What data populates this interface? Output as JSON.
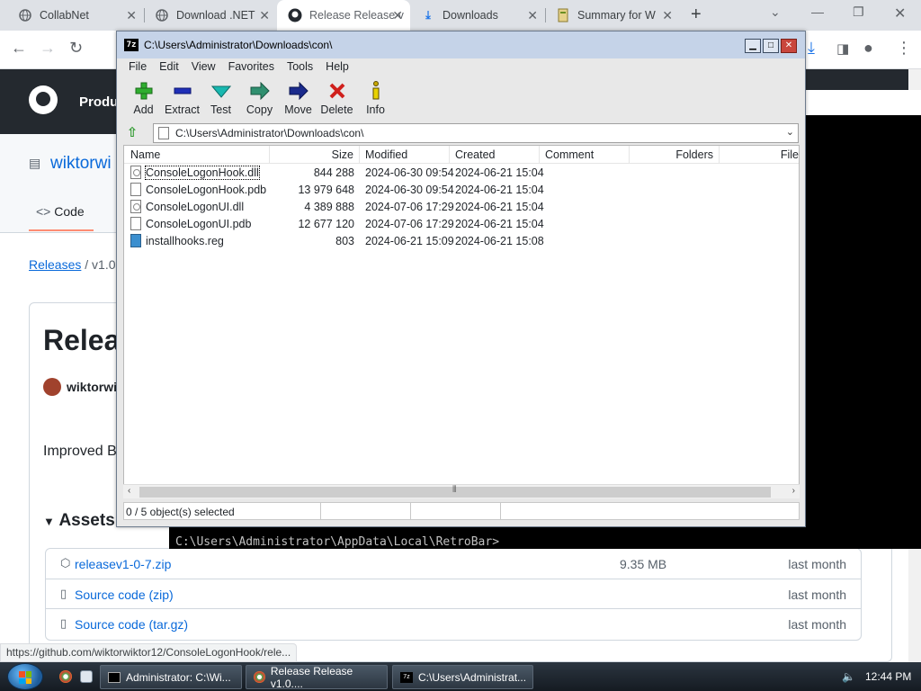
{
  "browser": {
    "tabs": [
      {
        "title": "CollabNet",
        "icon": "globe-icon"
      },
      {
        "title": "Download .NET",
        "icon": "globe-icon"
      },
      {
        "title": "Release Release v",
        "icon": "github-icon",
        "active": true
      },
      {
        "title": "Downloads",
        "icon": "download-icon"
      },
      {
        "title": "Summary for W",
        "icon": "summary-icon"
      }
    ],
    "status_url": "https://github.com/wiktorwiktor12/ConsoleLogonHook/rele..."
  },
  "github": {
    "nav_product": "Produ",
    "repo_name": "wiktorwi",
    "code_tab": "Code",
    "breadcrumb_link": "Releases",
    "breadcrumb_sep": "/",
    "breadcrumb_current": "v1.0.7",
    "release_title": "Relea",
    "author": "wiktorwi",
    "description": "Improved B",
    "assets_title": "Assets",
    "assets": [
      {
        "name": "releasev1-0-7.zip",
        "size": "9.35 MB",
        "date": "last month",
        "icon": "package-icon"
      },
      {
        "name": "Source code (zip)",
        "size": "",
        "date": "last month",
        "icon": "file-zip-icon"
      },
      {
        "name": "Source code (tar.gz)",
        "size": "",
        "date": "last month",
        "icon": "file-zip-icon"
      }
    ]
  },
  "console": {
    "prompt": "C:\\Users\\Administrator\\AppData\\Local\\RetroBar>"
  },
  "sevenzip": {
    "title": "C:\\Users\\Administrator\\Downloads\\con\\",
    "app_icon_text": "7z",
    "menu": [
      "File",
      "Edit",
      "View",
      "Favorites",
      "Tools",
      "Help"
    ],
    "tools": [
      {
        "label": "Add",
        "icon": "plus-icon",
        "color": "#2fae2f"
      },
      {
        "label": "Extract",
        "icon": "minus-icon",
        "color": "#1f2fb8"
      },
      {
        "label": "Test",
        "icon": "check-icon",
        "color": "#18b8b0"
      },
      {
        "label": "Copy",
        "icon": "copy-arrow-icon",
        "color": "#2f8f6f"
      },
      {
        "label": "Move",
        "icon": "move-arrow-icon",
        "color": "#1a2a8c"
      },
      {
        "label": "Delete",
        "icon": "delete-x-icon",
        "color": "#d0201c"
      },
      {
        "label": "Info",
        "icon": "info-icon",
        "color": "#c8a800"
      }
    ],
    "path": "C:\\Users\\Administrator\\Downloads\\con\\",
    "columns": [
      "Name",
      "Size",
      "Modified",
      "Created",
      "Comment",
      "Folders",
      "File"
    ],
    "files": [
      {
        "name": "ConsoleLogonHook.dll",
        "size": "844 288",
        "modified": "2024-06-30 09:54",
        "created": "2024-06-21 15:04",
        "type": "dll"
      },
      {
        "name": "ConsoleLogonHook.pdb",
        "size": "13 979 648",
        "modified": "2024-06-30 09:54",
        "created": "2024-06-21 15:04",
        "type": "pdb"
      },
      {
        "name": "ConsoleLogonUI.dll",
        "size": "4 389 888",
        "modified": "2024-07-06 17:29",
        "created": "2024-06-21 15:04",
        "type": "dll"
      },
      {
        "name": "ConsoleLogonUI.pdb",
        "size": "12 677 120",
        "modified": "2024-07-06 17:29",
        "created": "2024-06-21 15:04",
        "type": "pdb"
      },
      {
        "name": "installhooks.reg",
        "size": "803",
        "modified": "2024-06-21 15:09",
        "created": "2024-06-21 15:08",
        "type": "reg"
      }
    ],
    "status": "0 / 5 object(s) selected"
  },
  "taskbar": {
    "buttons": [
      {
        "label": "Administrator: C:\\Wi...",
        "icon": "console-icon"
      },
      {
        "label": "Release Release v1.0....",
        "icon": "chrome-icon"
      },
      {
        "label": "C:\\Users\\Administrat...",
        "icon": "sevenzip-icon"
      }
    ],
    "clock": "12:44 PM"
  }
}
